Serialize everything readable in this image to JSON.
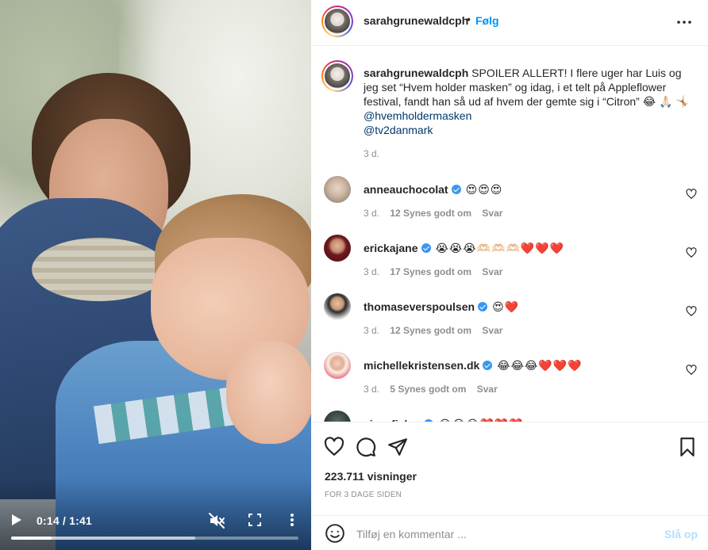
{
  "video": {
    "timecode": "0:14 / 1:41",
    "progress": 0.14,
    "buffered": 0.64,
    "icons": [
      "play-icon",
      "mute-icon",
      "fullscreen-icon",
      "more-vertical-icon"
    ]
  },
  "header": {
    "username": "sarahgrunewaldcph",
    "separator": "•",
    "follow_label": "Følg"
  },
  "caption": {
    "username": "sarahgrunewaldcph",
    "text": "SPOILER ALLERT! I flere uger har Luis og jeg set “Hvem holder masken” og idag, i et telt på Appleflower festival, fandt han så ud af hvem der gemte sig i “Citron” 😂 🙏🏻 🤸🏼",
    "mentions": [
      "@hvemholdermasken",
      "@tv2danmark"
    ],
    "time": "3 d."
  },
  "comments": [
    {
      "username": "anneauchocolat",
      "verified": true,
      "text": "😍😍😍",
      "time": "3 d.",
      "likes": "12 Synes godt om",
      "reply": "Svar"
    },
    {
      "username": "erickajane",
      "verified": true,
      "text": "😭😭😭🫶🏻🫶🏻🫶🏻❤️❤️❤️",
      "time": "3 d.",
      "likes": "17 Synes godt om",
      "reply": "Svar"
    },
    {
      "username": "thomaseverspoulsen",
      "verified": true,
      "text": "😍❤️",
      "time": "3 d.",
      "likes": "12 Synes godt om",
      "reply": "Svar"
    },
    {
      "username": "michellekristensen.dk",
      "verified": true,
      "text": "😂😂😂❤️❤️❤️",
      "time": "3 d.",
      "likes": "5 Synes godt om",
      "reply": "Svar"
    },
    {
      "username": "sissefisker",
      "verified": true,
      "text": "😂😂😂❤️❤️❤️",
      "time": "",
      "likes": "",
      "reply": ""
    }
  ],
  "stats": {
    "views": "223.711 visninger",
    "posted": "FOR 3 DAGE SIDEN"
  },
  "compose": {
    "placeholder": "Tilføj en kommentar ...",
    "post_label": "Slå op"
  },
  "colors": {
    "link": "#0095f6",
    "mention": "#00376b",
    "verified": "#3897f0",
    "post_disabled": "#b2dffc"
  }
}
